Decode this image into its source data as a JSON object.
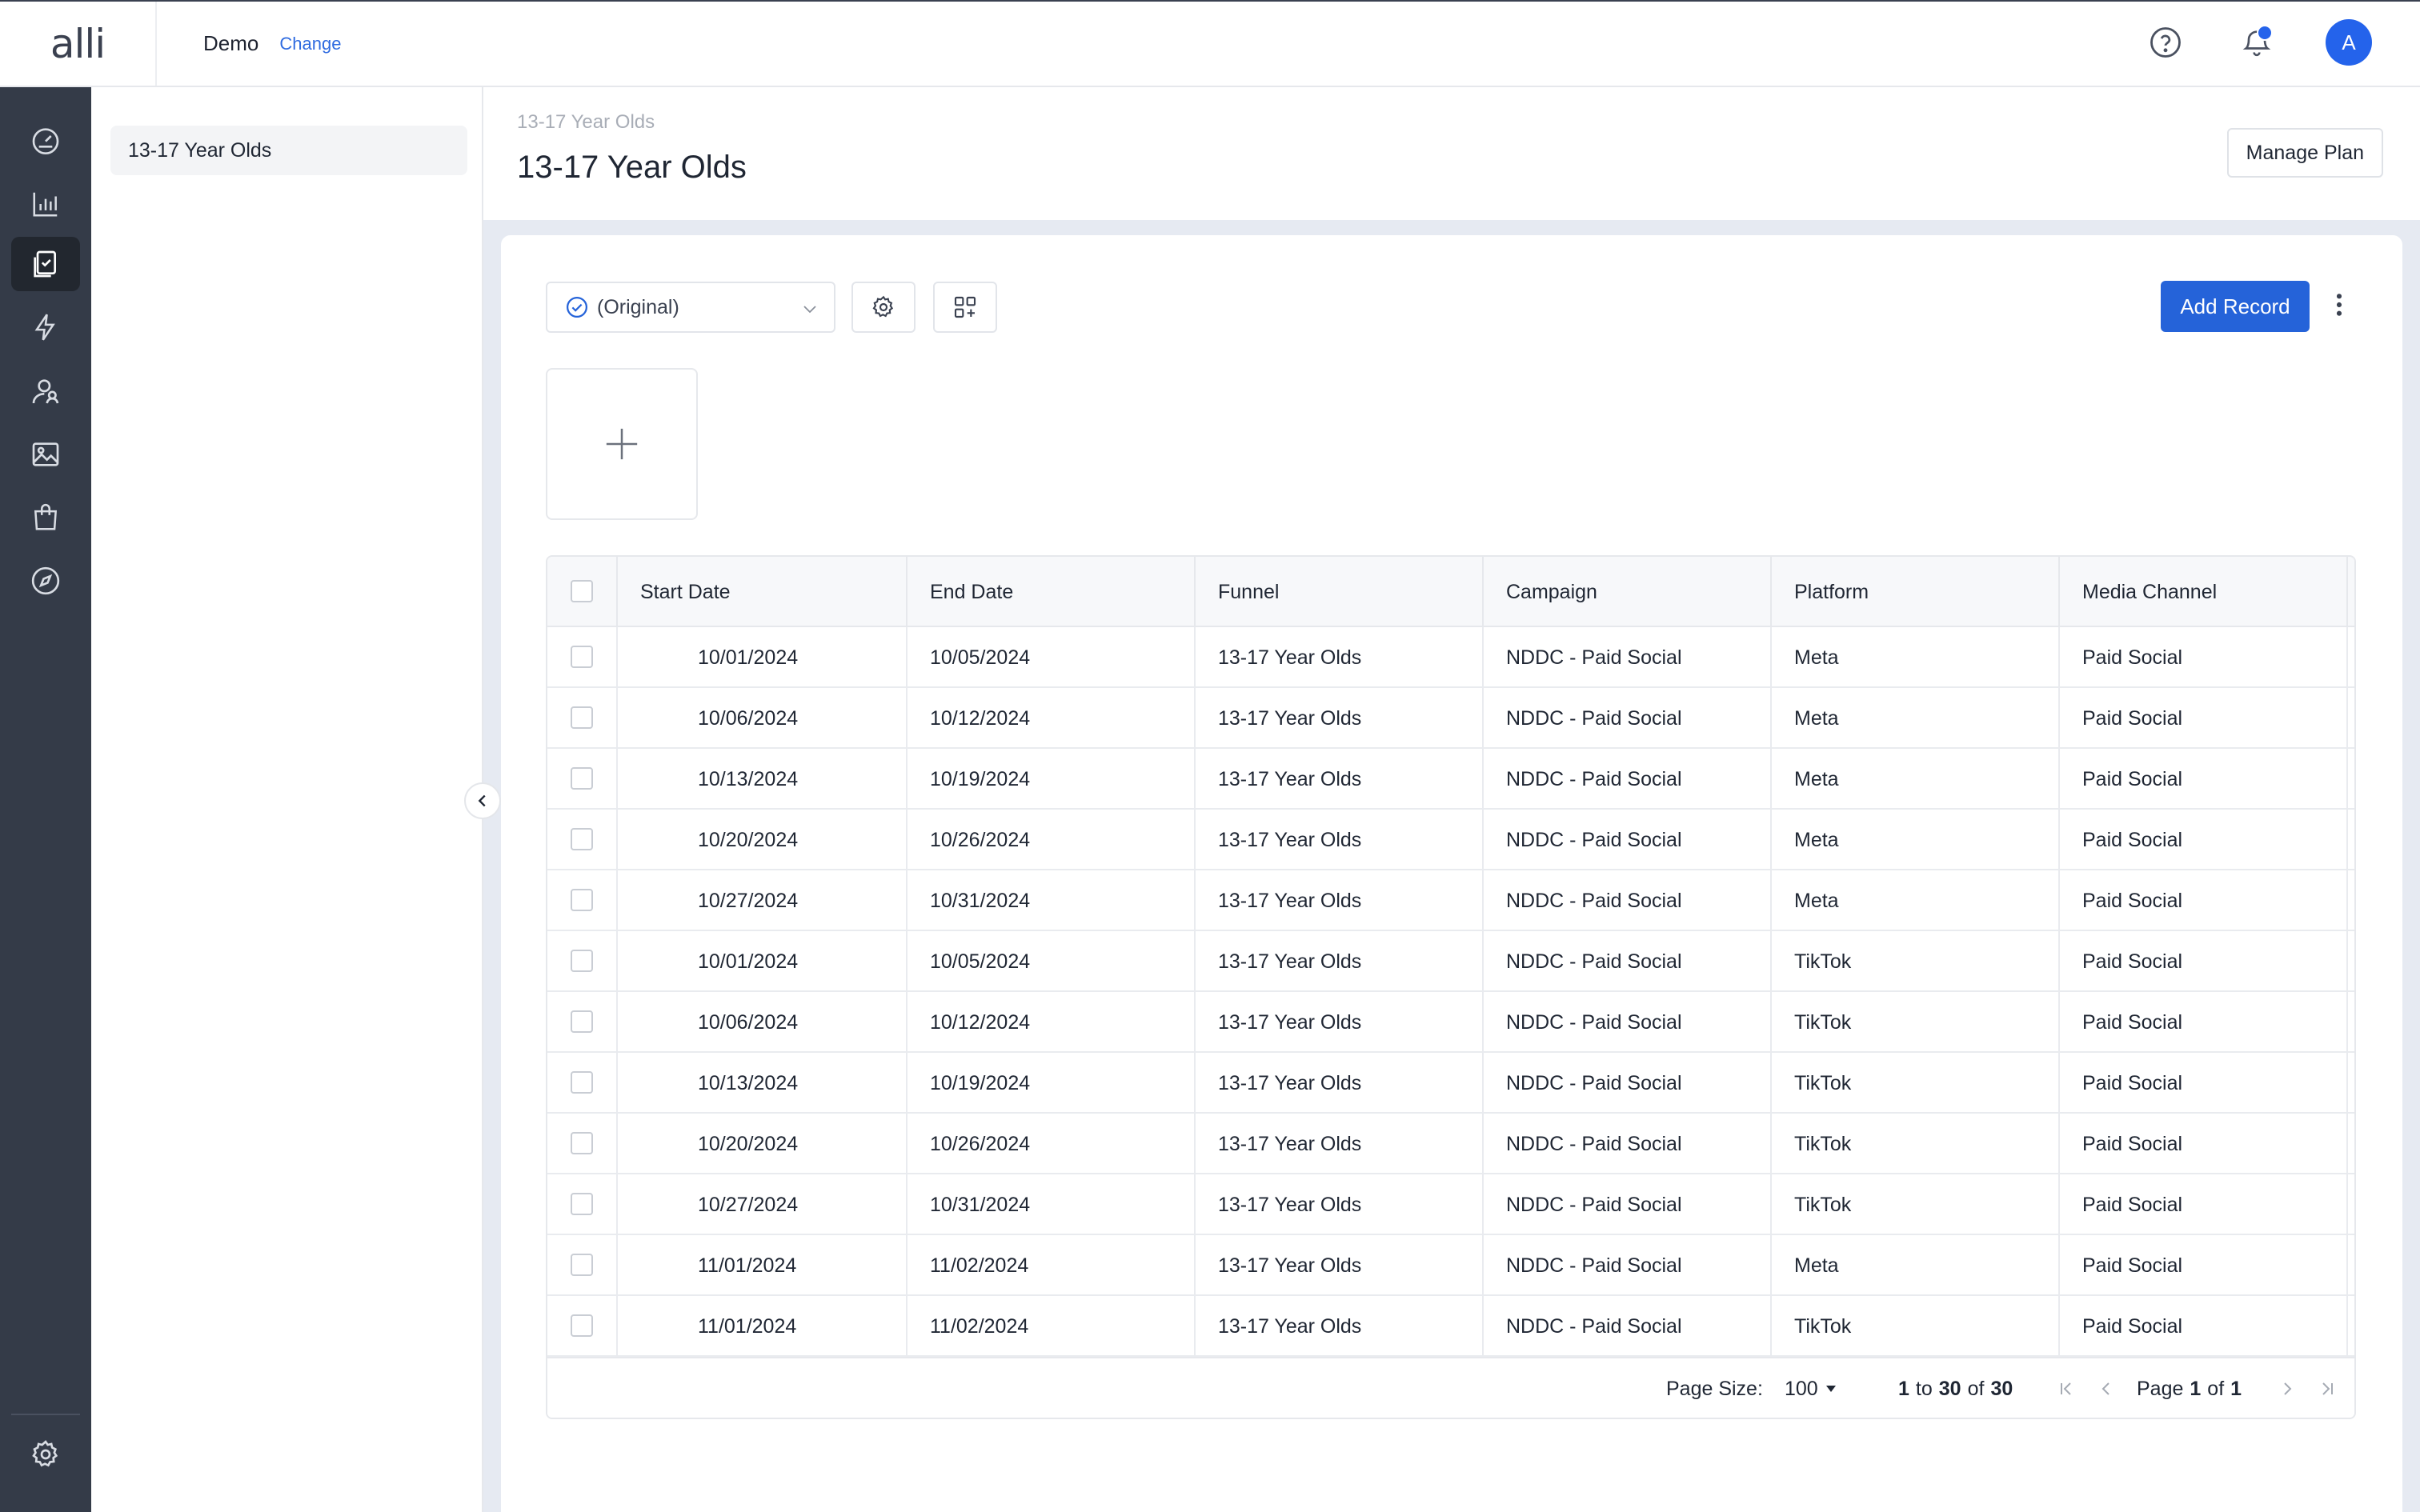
{
  "header": {
    "logo": "alli",
    "account_name": "Demo",
    "change_label": "Change"
  },
  "user": {
    "avatar_initial": "A"
  },
  "rail": {
    "items": [
      "dashboard-icon",
      "analytics-icon",
      "plans-icon",
      "actions-icon",
      "audiences-icon",
      "creative-icon",
      "marketplace-icon",
      "explore-icon"
    ],
    "settings": "gear-icon"
  },
  "subpanel": {
    "items": [
      {
        "label": "13-17 Year Olds"
      }
    ]
  },
  "page": {
    "breadcrumb": "13-17 Year Olds",
    "title": "13-17 Year Olds",
    "manage_plan_label": "Manage Plan"
  },
  "toolbar": {
    "version_label": "(Original)",
    "add_record_label": "Add Record"
  },
  "table": {
    "columns": [
      "Start Date",
      "End Date",
      "Funnel",
      "Campaign",
      "Platform",
      "Media Channel"
    ],
    "rows": [
      [
        "10/01/2024",
        "10/05/2024",
        "13-17 Year Olds",
        "NDDC - Paid Social",
        "Meta",
        "Paid Social"
      ],
      [
        "10/06/2024",
        "10/12/2024",
        "13-17 Year Olds",
        "NDDC - Paid Social",
        "Meta",
        "Paid Social"
      ],
      [
        "10/13/2024",
        "10/19/2024",
        "13-17 Year Olds",
        "NDDC - Paid Social",
        "Meta",
        "Paid Social"
      ],
      [
        "10/20/2024",
        "10/26/2024",
        "13-17 Year Olds",
        "NDDC - Paid Social",
        "Meta",
        "Paid Social"
      ],
      [
        "10/27/2024",
        "10/31/2024",
        "13-17 Year Olds",
        "NDDC - Paid Social",
        "Meta",
        "Paid Social"
      ],
      [
        "10/01/2024",
        "10/05/2024",
        "13-17 Year Olds",
        "NDDC - Paid Social",
        "TikTok",
        "Paid Social"
      ],
      [
        "10/06/2024",
        "10/12/2024",
        "13-17 Year Olds",
        "NDDC - Paid Social",
        "TikTok",
        "Paid Social"
      ],
      [
        "10/13/2024",
        "10/19/2024",
        "13-17 Year Olds",
        "NDDC - Paid Social",
        "TikTok",
        "Paid Social"
      ],
      [
        "10/20/2024",
        "10/26/2024",
        "13-17 Year Olds",
        "NDDC - Paid Social",
        "TikTok",
        "Paid Social"
      ],
      [
        "10/27/2024",
        "10/31/2024",
        "13-17 Year Olds",
        "NDDC - Paid Social",
        "TikTok",
        "Paid Social"
      ],
      [
        "11/01/2024",
        "11/02/2024",
        "13-17 Year Olds",
        "NDDC - Paid Social",
        "Meta",
        "Paid Social"
      ],
      [
        "11/01/2024",
        "11/02/2024",
        "13-17 Year Olds",
        "NDDC - Paid Social",
        "TikTok",
        "Paid Social"
      ]
    ]
  },
  "pagination": {
    "page_size_label": "Page Size:",
    "page_size": "100",
    "range_from": "1",
    "range_to_word": "to",
    "range_to": "30",
    "of_word": "of",
    "total": "30",
    "page_word": "Page",
    "current_page": "1",
    "total_pages": "1"
  },
  "colors": {
    "accent": "#2563d9",
    "rail": "#343b48",
    "rail_active": "#22272f",
    "content_bg": "#e6eaf2"
  }
}
